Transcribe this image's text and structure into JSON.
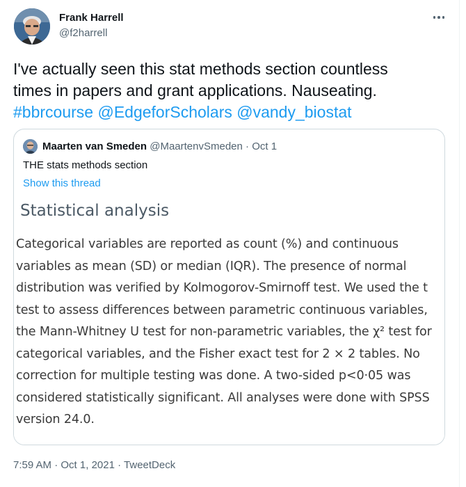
{
  "tweet": {
    "author": {
      "name": "Frank Harrell",
      "handle": "@f2harrell"
    },
    "more_icon": "more-horizontal-icon",
    "text_lines": [
      {
        "plain": "I've actually seen this stat methods section countless"
      },
      {
        "plain": "times in papers and grant applications.  Nauseating."
      }
    ],
    "tags": [
      "#bbrcourse",
      "@EdgeforScholars",
      "@vandy_biostat"
    ],
    "timestamp": {
      "time": "7:59 AM",
      "sep1": "·",
      "date": "Oct 1, 2021",
      "sep2": "·",
      "source": "TweetDeck"
    }
  },
  "quote": {
    "author": {
      "name": "Maarten van Smeden",
      "handle": "@MaartenvSmeden"
    },
    "sep": "·",
    "date": "Oct 1",
    "text": "THE stats methods section",
    "show_thread": "Show this thread",
    "image": {
      "heading": "Statistical analysis",
      "lines": [
        "Categorical variables are reported as count (%) and continuous",
        "variables as mean (SD) or median (IQR). The presence of normal",
        "distribution was verified by Kolmogorov-Smirnoff test. We used the t",
        "test to assess differences between parametric continuous variables,",
        "the Mann-Whitney U test for non-parametric variables, the χ² test for",
        "categorical variables, and the Fisher exact test for 2 × 2 tables. No",
        "correction for multiple testing was done. A two-sided p<0·05 was",
        "considered statistically significant. All analyses were done with SPSS",
        "version 24.0."
      ]
    }
  },
  "colors": {
    "link": "#1d9bf0",
    "text": "#0f1419",
    "muted": "#536471",
    "border": "#cfd9de"
  }
}
